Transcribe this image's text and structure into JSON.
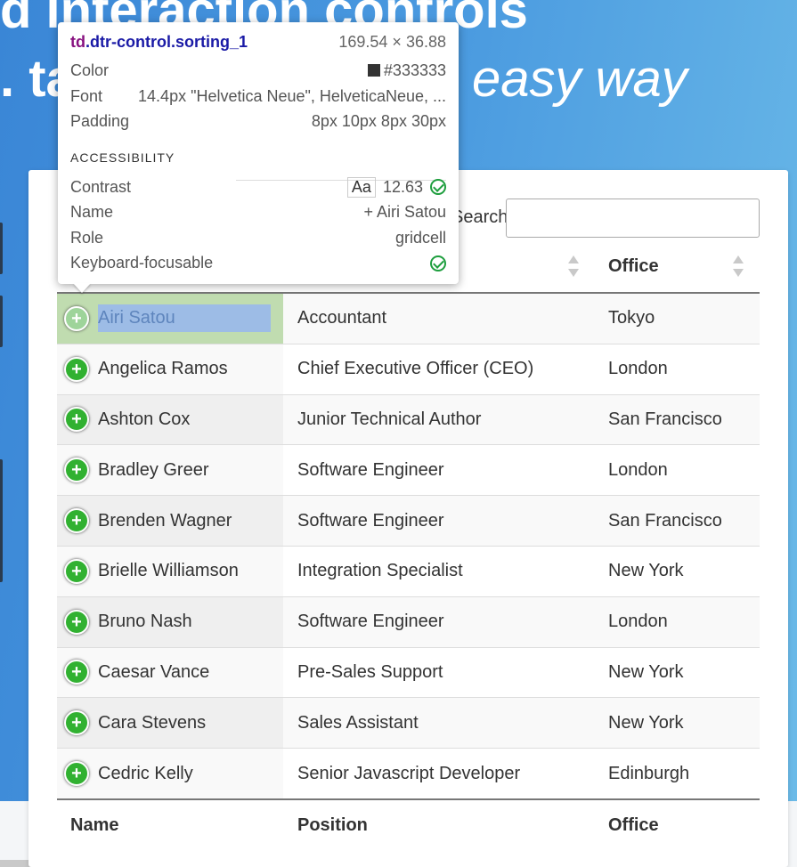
{
  "hero": {
    "line1": "d interaction controls",
    "line2_left": ". ta",
    "line2_right": "easy way"
  },
  "search": {
    "label": "Search:",
    "value": ""
  },
  "columns": {
    "name": "Name",
    "position": "Position",
    "office": "Office"
  },
  "rows": [
    {
      "name": "Airi Satou",
      "position": "Accountant",
      "office": "Tokyo"
    },
    {
      "name": "Angelica Ramos",
      "position": "Chief Executive Officer (CEO)",
      "office": "London"
    },
    {
      "name": "Ashton Cox",
      "position": "Junior Technical Author",
      "office": "San Francisco"
    },
    {
      "name": "Bradley Greer",
      "position": "Software Engineer",
      "office": "London"
    },
    {
      "name": "Brenden Wagner",
      "position": "Software Engineer",
      "office": "San Francisco"
    },
    {
      "name": "Brielle Williamson",
      "position": "Integration Specialist",
      "office": "New York"
    },
    {
      "name": "Bruno Nash",
      "position": "Software Engineer",
      "office": "London"
    },
    {
      "name": "Caesar Vance",
      "position": "Pre-Sales Support",
      "office": "New York"
    },
    {
      "name": "Cara Stevens",
      "position": "Sales Assistant",
      "office": "New York"
    },
    {
      "name": "Cedric Kelly",
      "position": "Senior Javascript Developer",
      "office": "Edinburgh"
    }
  ],
  "expand_icon": "plus-circle-icon",
  "tooltip": {
    "selector_tag": "td",
    "selector_class": ".dtr-control.sorting_1",
    "dimensions": "169.54 × 36.88",
    "color_label": "Color",
    "color_value": "#333333",
    "font_label": "Font",
    "font_value": "14.4px \"Helvetica Neue\", HelveticaNeue, ...",
    "padding_label": "Padding",
    "padding_value": "8px 10px 8px 30px",
    "accessibility_heading": "ACCESSIBILITY",
    "contrast_label": "Contrast",
    "contrast_aa": "Aa",
    "contrast_value": "12.63",
    "name_label": "Name",
    "name_value": "+ Airi Satou",
    "role_label": "Role",
    "role_value": "gridcell",
    "focusable_label": "Keyboard-focusable"
  },
  "colors": {
    "plus_green": "#31b131",
    "selection_blue": "#9dbce6",
    "highlight_green": "#c0dcb0",
    "check_green": "#1e9e3e"
  }
}
